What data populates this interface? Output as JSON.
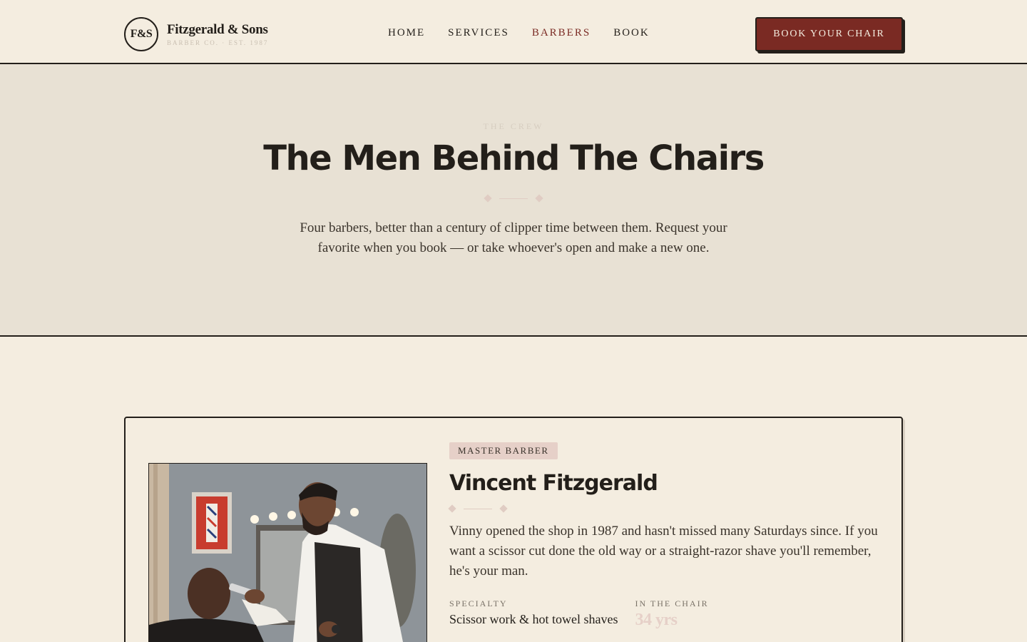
{
  "brand": {
    "mark": "F&S",
    "name": "Fitzgerald & Sons",
    "tagline": "BARBER CO. · EST. 1987"
  },
  "nav": {
    "items": [
      {
        "label": "HOME"
      },
      {
        "label": "SERVICES"
      },
      {
        "label": "BARBERS"
      },
      {
        "label": "BOOK"
      }
    ],
    "active": "BARBERS"
  },
  "header": {
    "cta_label": "BOOK YOUR CHAIR"
  },
  "hero": {
    "eyebrow": "THE CREW",
    "title": "The Men Behind The Chairs",
    "description": "Four barbers, better than a century of clipper time between them. Request your favorite when you book — or take whoever's open and make a new one."
  },
  "barber": {
    "role": "MASTER BARBER",
    "name": "Vincent Fitzgerald",
    "bio": "Vinny opened the shop in 1987 and hasn't missed many Saturdays since. If you want a scissor cut done the old way or a straight-razor shave you'll remember, he's your man.",
    "specialty_label": "SPECIALTY",
    "specialty": "Scissor work & hot towel shaves",
    "tenure_label": "IN THE CHAIR",
    "tenure": "34 yrs"
  },
  "colors": {
    "background": "#f4ede0",
    "hero_bg": "#e8e1d4",
    "accent": "#7a2a23",
    "ink": "#231f1a",
    "badge": "#e6d0c8"
  }
}
